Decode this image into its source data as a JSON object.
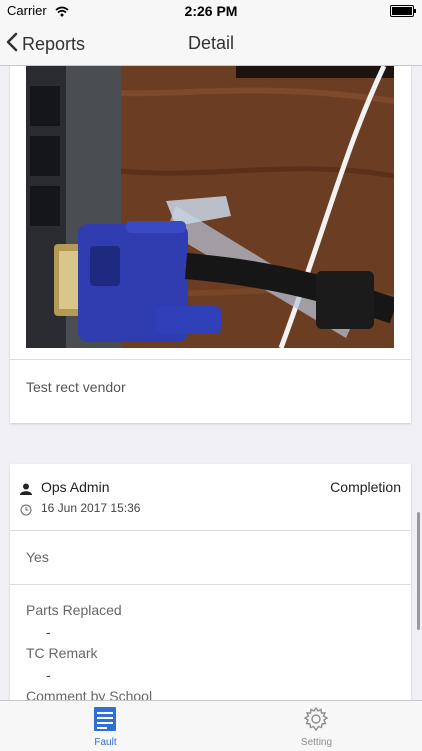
{
  "status_bar": {
    "carrier": "Carrier",
    "time": "2:26 PM"
  },
  "nav": {
    "back_label": "Reports",
    "title": "Detail"
  },
  "cards": {
    "photo_card": {
      "caption": "Test rect vendor"
    },
    "comment_card": {
      "author": "Ops Admin",
      "status": "Completion",
      "timestamp": "16 Jun 2017 15:36",
      "answer": "Yes",
      "parts_label": "Parts Replaced",
      "parts_value": "-",
      "tc_label": "TC Remark",
      "tc_value": "-",
      "comment_label": "Comment by School"
    }
  },
  "tabbar": {
    "items": [
      {
        "label": "Fault",
        "icon": "document-list-icon",
        "active": true
      },
      {
        "label": "Setting",
        "icon": "gear-icon",
        "active": false
      }
    ]
  },
  "colors": {
    "accent": "#2f6fd6",
    "background": "#efeff4"
  }
}
